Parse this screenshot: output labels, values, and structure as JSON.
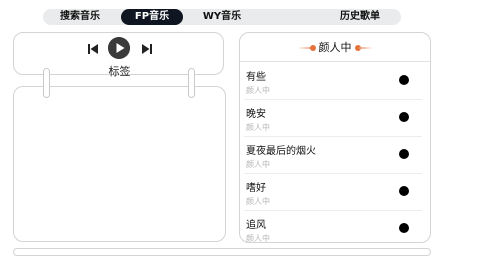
{
  "nav": {
    "tabs": [
      {
        "label": "搜索音乐",
        "active": false
      },
      {
        "label": "FP音乐",
        "active": true
      },
      {
        "label": "WY音乐",
        "active": false
      },
      {
        "label": "历史歌单",
        "active": false
      }
    ]
  },
  "player": {
    "tag_label": "标签",
    "icons": [
      "skip-previous-icon",
      "play-icon",
      "skip-next-icon"
    ]
  },
  "playlist": {
    "title": "颜人中",
    "songs": [
      {
        "name": "有些",
        "artist": "颜人中"
      },
      {
        "name": "晚安",
        "artist": "颜人中"
      },
      {
        "name": "夏夜最后的烟火",
        "artist": "颜人中"
      },
      {
        "name": "嗜好",
        "artist": "颜人中"
      },
      {
        "name": "追风",
        "artist": "颜人中"
      }
    ]
  },
  "colors": {
    "active_tab_bg": "#0f1622",
    "nav_bg": "#e9ebec",
    "accent_orange": "#e4723c",
    "border": "#d4d4d4",
    "artist_text": "#b5b5b5"
  }
}
